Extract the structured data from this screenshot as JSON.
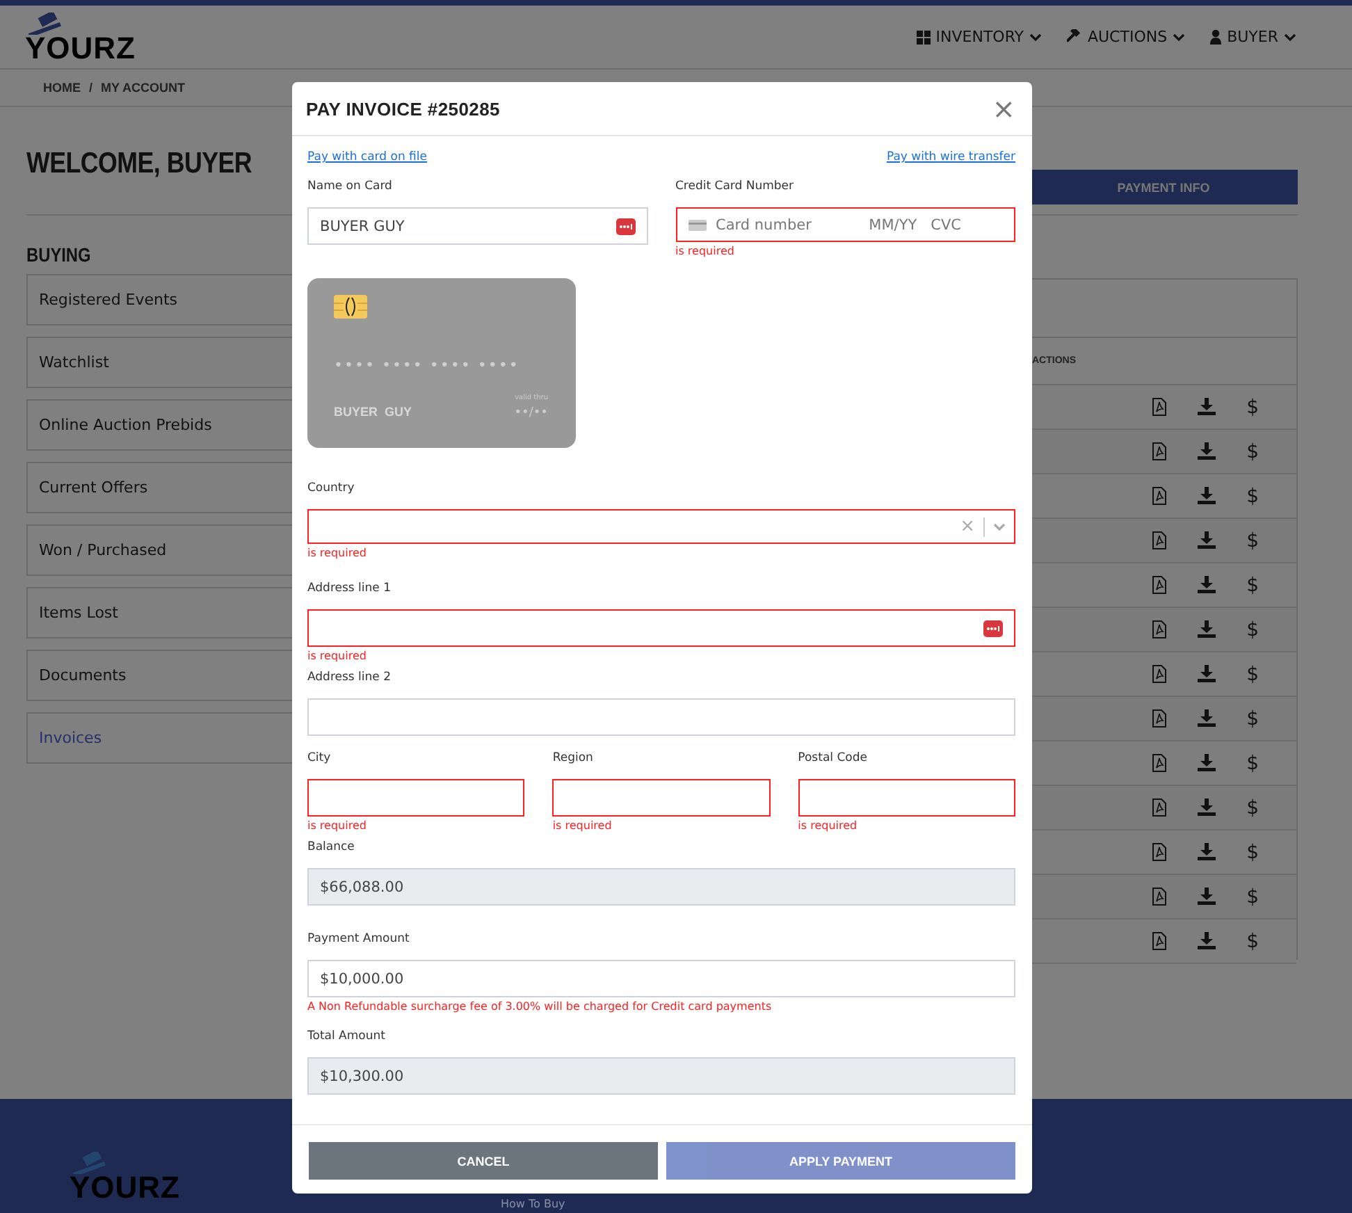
{
  "header": {
    "logo": "YOURZ",
    "nav": [
      {
        "label": "INVENTORY"
      },
      {
        "label": "AUCTIONS"
      },
      {
        "label": "BUYER"
      }
    ]
  },
  "breadcrumb": {
    "items": [
      "HOME",
      "MY ACCOUNT"
    ],
    "separator": "/"
  },
  "welcome": "WELCOME, BUYER",
  "payment_info_button": "PAYMENT INFO",
  "sidebar": {
    "heading": "BUYING",
    "items": [
      {
        "label": "Registered Events",
        "selected": false
      },
      {
        "label": "Watchlist",
        "selected": false
      },
      {
        "label": "Online Auction Prebids",
        "selected": false
      },
      {
        "label": "Current Offers",
        "selected": false
      },
      {
        "label": "Won / Purchased",
        "selected": false
      },
      {
        "label": "Items Lost",
        "selected": false
      },
      {
        "label": "Documents",
        "selected": false
      },
      {
        "label": "Invoices",
        "selected": true
      }
    ]
  },
  "table": {
    "actions_heading": "ACTIONS",
    "rows": [
      {
        "pay_symbol": "$"
      },
      {
        "pay_symbol": "$"
      },
      {
        "pay_symbol": "$"
      },
      {
        "pay_symbol": "$"
      },
      {
        "pay_symbol": "$"
      },
      {
        "pay_symbol": "$"
      },
      {
        "pay_symbol": "$"
      },
      {
        "pay_symbol": "$"
      },
      {
        "pay_symbol": "$"
      },
      {
        "pay_symbol": "$"
      },
      {
        "pay_symbol": "$"
      },
      {
        "pay_symbol": "$"
      },
      {
        "pay_symbol": "$"
      }
    ]
  },
  "footer": {
    "logo": "YOURZ",
    "link": "How To Buy"
  },
  "modal": {
    "title": "PAY INVOICE #250285",
    "close": "×",
    "links": [
      "Pay with card on file",
      "Pay with wire transfer"
    ],
    "name_on_card": {
      "label": "Name on Card",
      "value": "BUYER GUY",
      "autofill": true
    },
    "card_number": {
      "label": "Credit Card Number",
      "placeholders": [
        "Card number",
        "MM/YY",
        "CVC"
      ],
      "invalid": true,
      "error": "is required"
    },
    "card_preview": {
      "number": "•••• •••• •••• ••••",
      "name": "BUYER  GUY",
      "valid_label": "valid thru",
      "expiry": "••/••"
    },
    "country": {
      "label": "Country",
      "clear": "×",
      "invalid": true,
      "error": "is required"
    },
    "address1": {
      "label": "Address line 1",
      "invalid": true,
      "autofill": true,
      "error": "is required"
    },
    "address2": {
      "label": "Address line 2",
      "invalid": false
    },
    "location": [
      {
        "label": "City",
        "invalid": true,
        "error": "is required"
      },
      {
        "label": "Region",
        "invalid": true,
        "error": "is required"
      },
      {
        "label": "Postal Code",
        "invalid": true,
        "error": "is required"
      }
    ],
    "balance": {
      "label": "Balance",
      "value": "$66,088.00",
      "readonly": true
    },
    "payment_amount": {
      "label": "Payment Amount",
      "value": "$10,000.00",
      "readonly": false
    },
    "surcharge_note": "A Non Refundable surcharge fee of 3.00% will be charged for Credit card payments",
    "total_amount": {
      "label": "Total Amount",
      "value": "$10,300.00",
      "readonly": true
    },
    "buttons": [
      {
        "label": "CANCEL",
        "kind": "cancel",
        "disabled": false
      },
      {
        "label": "APPLY PAYMENT",
        "kind": "apply",
        "disabled": true
      }
    ]
  }
}
